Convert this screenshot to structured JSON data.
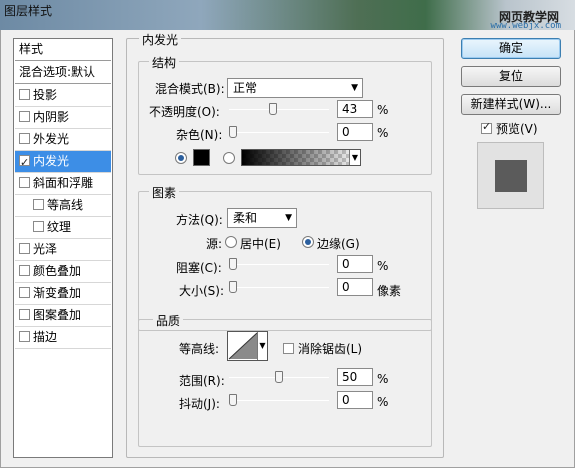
{
  "window": {
    "title": "图层样式",
    "watermark_text": "网页教学网",
    "watermark_url": "www.webjx.com"
  },
  "style_list": {
    "header": "样式",
    "blend_default": "混合选项:默认",
    "items": [
      {
        "label": "投影",
        "checked": false,
        "selected": false,
        "sub": false
      },
      {
        "label": "内阴影",
        "checked": false,
        "selected": false,
        "sub": false
      },
      {
        "label": "外发光",
        "checked": false,
        "selected": false,
        "sub": false
      },
      {
        "label": "内发光",
        "checked": true,
        "selected": true,
        "sub": false
      },
      {
        "label": "斜面和浮雕",
        "checked": false,
        "selected": false,
        "sub": false
      },
      {
        "label": "等高线",
        "checked": false,
        "selected": false,
        "sub": true
      },
      {
        "label": "纹理",
        "checked": false,
        "selected": false,
        "sub": true
      },
      {
        "label": "光泽",
        "checked": false,
        "selected": false,
        "sub": false
      },
      {
        "label": "颜色叠加",
        "checked": false,
        "selected": false,
        "sub": false
      },
      {
        "label": "渐变叠加",
        "checked": false,
        "selected": false,
        "sub": false
      },
      {
        "label": "图案叠加",
        "checked": false,
        "selected": false,
        "sub": false
      },
      {
        "label": "描边",
        "checked": false,
        "selected": false,
        "sub": false
      }
    ]
  },
  "inner_glow": {
    "title": "内发光",
    "structure": {
      "title": "结构",
      "blend_mode_label": "混合模式(B):",
      "blend_mode_value": "正常",
      "opacity_label": "不透明度(O):",
      "opacity_value": "43",
      "opacity_unit": "%",
      "opacity_level": 0.43,
      "noise_label": "杂色(N):",
      "noise_value": "0",
      "noise_unit": "%",
      "noise_level": 0,
      "color_mode": "solid",
      "solid_color": "#000000"
    },
    "elements": {
      "title": "图素",
      "technique_label": "方法(Q):",
      "technique_value": "柔和",
      "source_label": "源:",
      "source_center": "居中(E)",
      "source_edge": "边缘(G)",
      "source_selected": "edge",
      "choke_label": "阻塞(C):",
      "choke_value": "0",
      "choke_unit": "%",
      "choke_level": 0,
      "size_label": "大小(S):",
      "size_value": "0",
      "size_unit": "像素",
      "size_level": 0
    },
    "quality": {
      "title": "品质",
      "contour_label": "等高线:",
      "antialias_label": "消除锯齿(L)",
      "antialias_checked": false,
      "range_label": "范围(R):",
      "range_value": "50",
      "range_unit": "%",
      "range_level": 0.5,
      "jitter_label": "抖动(J):",
      "jitter_value": "0",
      "jitter_unit": "%",
      "jitter_level": 0
    }
  },
  "buttons": {
    "ok": "确定",
    "reset": "复位",
    "new_style": "新建样式(W)...",
    "preview_label": "预览(V)",
    "preview_checked": true
  },
  "colors": {
    "selection": "#3d8ee6",
    "preview_swatch": "#5b5b5b"
  }
}
